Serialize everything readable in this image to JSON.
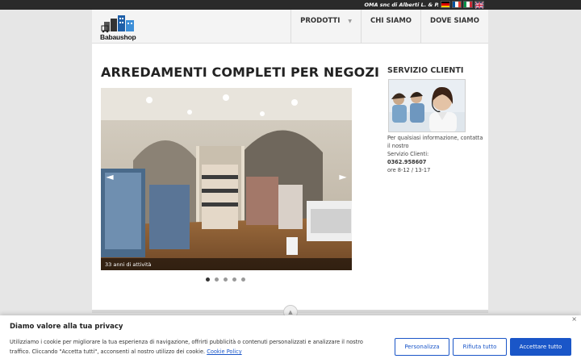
{
  "topbar": {
    "company": "OMA snc di Alberti L. & P.",
    "flags": [
      {
        "name": "german-flag-icon",
        "colors": [
          "#000000",
          "#dd0000",
          "#ffce00"
        ]
      },
      {
        "name": "french-flag-icon",
        "colors": [
          "#0055a4",
          "#ffffff",
          "#ef4135"
        ]
      },
      {
        "name": "italian-flag-icon",
        "colors": [
          "#009246",
          "#ffffff",
          "#ce2b37"
        ]
      },
      {
        "name": "uk-flag-icon",
        "colors": [
          "#012169",
          "#ffffff",
          "#c8102e"
        ]
      }
    ]
  },
  "header": {
    "logo_text": "Babaushop",
    "nav": [
      {
        "label": "PRODOTTI",
        "has_dropdown": true
      },
      {
        "label": "CHI SIAMO",
        "has_dropdown": false
      },
      {
        "label": "DOVE SIAMO",
        "has_dropdown": false
      }
    ]
  },
  "main": {
    "title": "ARREDAMENTI COMPLETI PER NEGOZI",
    "slider": {
      "caption": "33 anni di attività",
      "prev_icon": "arrow-left-icon",
      "next_icon": "arrow-right-icon",
      "slide_count": 5,
      "active_index": 0
    }
  },
  "sidebar": {
    "title": "SERVIZIO CLIENTI",
    "text_line1": "Per qualsiasi informazione, contatta il nostro",
    "text_line2": "Servizio Clienti:",
    "phone": "0362.958607",
    "hours": "ore 8-12 / 13-17"
  },
  "cookie_banner": {
    "title": "Diamo valore alla tua privacy",
    "close": "×",
    "text": "Utilizziamo i cookie per migliorare la tua esperienza di navigazione, offrirti pubblicità o contenuti personalizzati e analizzare il nostro traffico. Cliccando \"Accetta tutti\", acconsenti al nostro utilizzo dei cookie.",
    "link": "Cookie Policy",
    "customize_label": "Personalizza",
    "reject_label": "Rifiuta tutto",
    "accept_label": "Accettare tutto",
    "accent_color": "#1a56c8"
  }
}
